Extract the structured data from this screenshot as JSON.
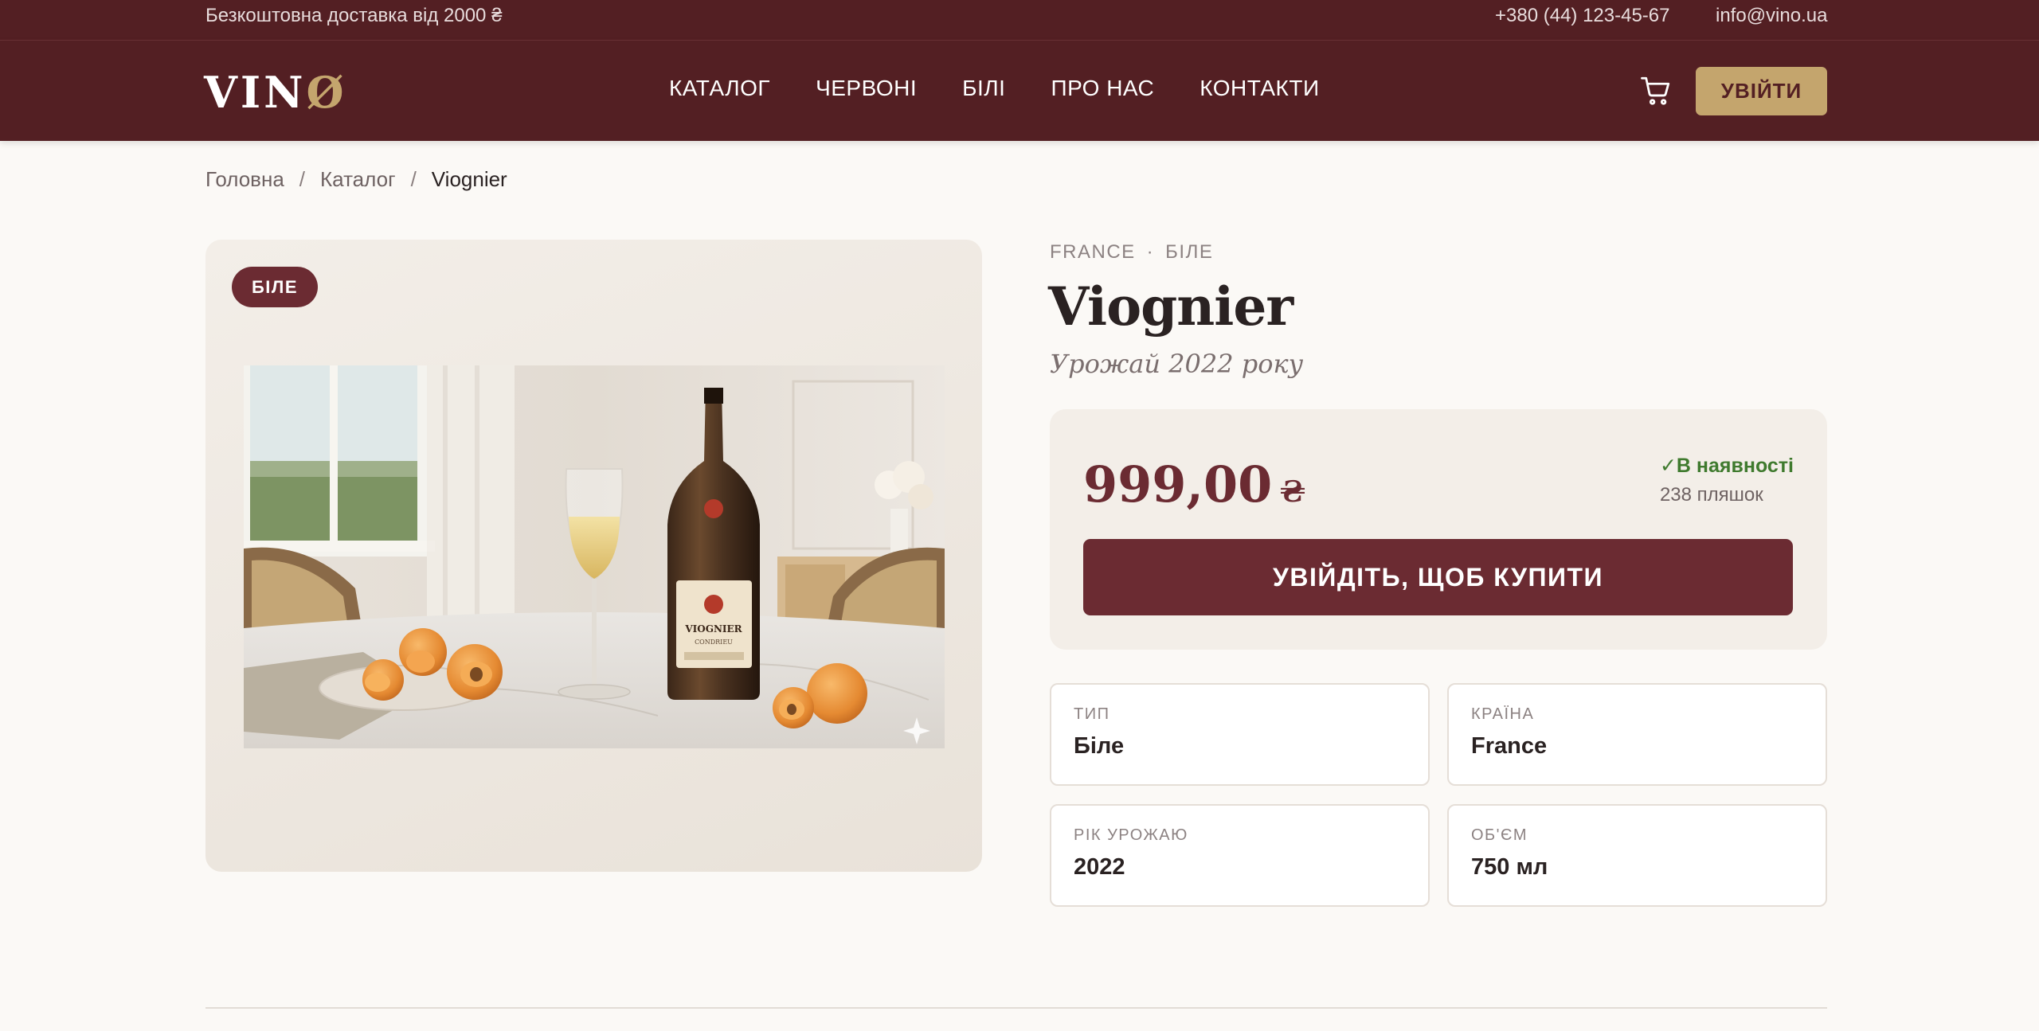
{
  "topbar": {
    "promo": "Безкоштовна доставка від 2000 ₴",
    "phone": "+380 (44) 123-45-67",
    "email": "info@vino.ua"
  },
  "header": {
    "logo_main": "VIN",
    "logo_accent": "Ø",
    "nav": [
      "КАТАЛОГ",
      "ЧЕРВОНІ",
      "БІЛІ",
      "ПРО НАС",
      "КОНТАКТИ"
    ],
    "login_label": "УВІЙТИ"
  },
  "breadcrumb": {
    "home": "Головна",
    "catalog": "Каталог",
    "current": "Viognier",
    "separator": "/"
  },
  "product": {
    "badge": "БІЛЕ",
    "country": "FRANCE",
    "origin_separator": "·",
    "type_short": "БІЛЕ",
    "title": "Viognier",
    "vintage": "Урожай 2022 року",
    "price": "999,00",
    "currency": "₴",
    "stock_status": "В наявності",
    "stock_check": "✓",
    "stock_count": "238 пляшок",
    "buy_label": "УВІЙДІТЬ, ЩОБ КУПИТИ",
    "bottle_label": "VIOGNIER",
    "bottle_sublabel": "CONDRIEU"
  },
  "specs": [
    {
      "label": "ТИП",
      "value": "Біле"
    },
    {
      "label": "КРАЇНА",
      "value": "France"
    },
    {
      "label": "РІК УРОЖАЮ",
      "value": "2022"
    },
    {
      "label": "ОБ'ЄМ",
      "value": "750 мл"
    }
  ],
  "colors": {
    "brand": "#531f23",
    "accent": "#c4a56d",
    "button": "#6b2b32",
    "in_stock": "#3f7a2e"
  },
  "icons": {
    "cart": "shopping-cart-icon",
    "check": "check-icon"
  }
}
